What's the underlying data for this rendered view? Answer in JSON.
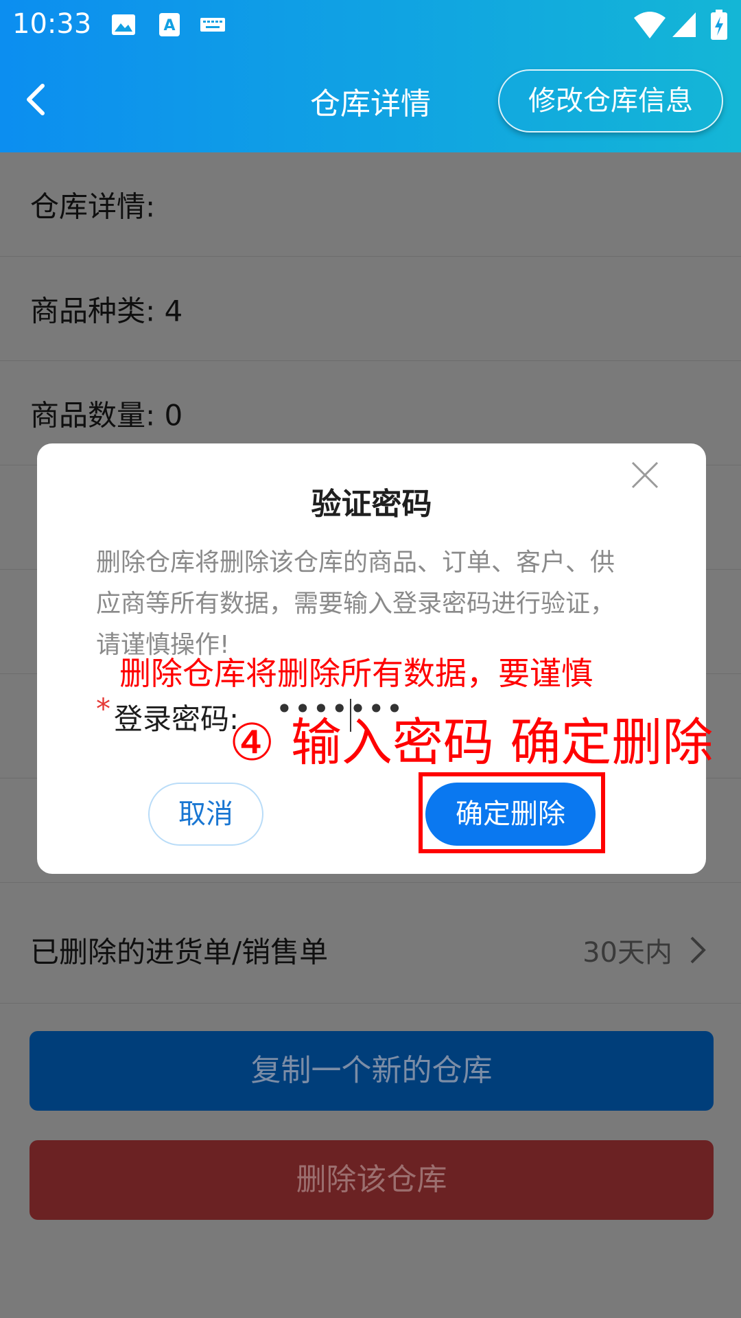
{
  "status_bar": {
    "time": "10:33",
    "icons": [
      "image-icon",
      "text-a-icon",
      "keyboard-icon",
      "wifi-icon",
      "signal-icon",
      "battery-charging-icon"
    ]
  },
  "header": {
    "title": "仓库详情",
    "edit_button": "修改仓库信息",
    "gradient": [
      "#0c8ef0",
      "#14b6d6"
    ]
  },
  "details": {
    "rows": [
      {
        "label": "仓库详情:",
        "value": ""
      },
      {
        "label": "商品种类:",
        "value": "4"
      },
      {
        "label": "商品数量:",
        "value": "0"
      }
    ],
    "deleted_orders": {
      "label": "已删除的进货单/销售单",
      "right": "30天内"
    }
  },
  "buttons": {
    "copy": "复制一个新的仓库",
    "delete": "删除该仓库"
  },
  "dialog": {
    "title": "验证密码",
    "message": "删除仓库将删除该仓库的商品、订单、客户、供应商等所有数据，需要输入登录密码进行验证，请谨慎操作!",
    "password_label": "登录密码:",
    "required_mark": "*",
    "password_value": "•••••••",
    "cancel": "取消",
    "confirm": "确定删除"
  },
  "annotations": {
    "note": "删除仓库将删除所有数据，要谨慎",
    "step": "④ 输入密码 确定删除"
  }
}
